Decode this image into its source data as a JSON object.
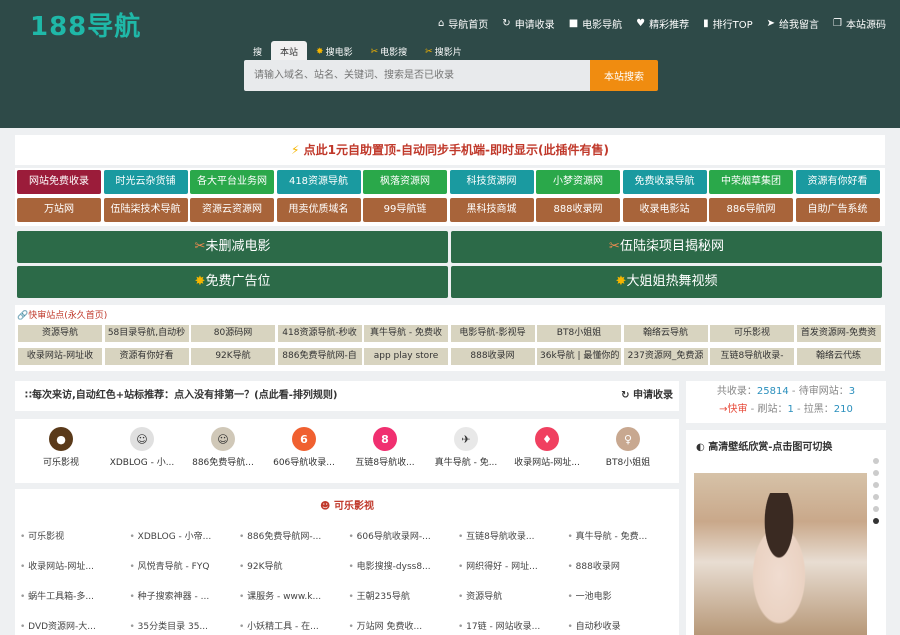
{
  "logo": "188导航",
  "topnav": [
    {
      "icon": "home-icon",
      "glyph": "⌂",
      "label": "导航首页"
    },
    {
      "icon": "refresh-icon",
      "glyph": "↻",
      "label": "申请收录"
    },
    {
      "icon": "video-icon",
      "glyph": "■",
      "label": "电影导航"
    },
    {
      "icon": "heart-icon",
      "glyph": "♥",
      "label": "精彩推荐"
    },
    {
      "icon": "chart-icon",
      "glyph": "▮",
      "label": "排行TOP"
    },
    {
      "icon": "send-icon",
      "glyph": "➤",
      "label": "给我留言"
    },
    {
      "icon": "copy-icon",
      "glyph": "❐",
      "label": "本站源码"
    }
  ],
  "search": {
    "prefix": "搜",
    "tabs": [
      "本站",
      "搜电影",
      "电影搜",
      "搜影片"
    ],
    "placeholder": "请输入域名、站名、关键词、搜索是否已收录",
    "button": "本站搜索"
  },
  "promo": "点此1元自助置顶-自动同步手机端-即时显示(此插件有售)",
  "grid_row1": [
    {
      "label": "网站免费收录",
      "color": "#9b1c3a"
    },
    {
      "label": "时光云杂货铺",
      "color": "#1a9aa0"
    },
    {
      "label": "各大平台业务网",
      "color": "#2aa84a"
    },
    {
      "label": "418资源导航",
      "color": "#1a9aa0"
    },
    {
      "label": "枫落资源网",
      "color": "#2aa84a"
    },
    {
      "label": "科技货源网",
      "color": "#1a9aa0"
    },
    {
      "label": "小梦资源网",
      "color": "#2aa84a"
    },
    {
      "label": "免费收录导航",
      "color": "#1a9aa0"
    },
    {
      "label": "中荣烟草集团",
      "color": "#2aa84a"
    },
    {
      "label": "资源有你好看",
      "color": "#1a9aa0"
    }
  ],
  "grid_row2": [
    {
      "label": "万站网",
      "color": "#a8643a"
    },
    {
      "label": "伍陆柒技术导航",
      "color": "#a8643a"
    },
    {
      "label": "资源云资源网",
      "color": "#a8643a"
    },
    {
      "label": "甩卖优质域名",
      "color": "#a8643a"
    },
    {
      "label": "99导航链",
      "color": "#a8643a"
    },
    {
      "label": "黑科技商城",
      "color": "#a8643a"
    },
    {
      "label": "888收录网",
      "color": "#a8643a"
    },
    {
      "label": "收录电影站",
      "color": "#a8643a"
    },
    {
      "label": "886导航网",
      "color": "#a8643a"
    },
    {
      "label": "自助广告系统",
      "color": "#a8643a"
    }
  ],
  "big_buttons": [
    "未删减电影",
    "伍陆柒项目揭秘网",
    "免费广告位",
    "大姐姐热舞视频"
  ],
  "quick_title": "快审站点(永久首页)",
  "quick_row1": [
    "资源导航",
    "58目录导航,自动秒",
    "80源码网",
    "418资源导航-秒收",
    "真牛导航 - 免费收",
    "电影导航-影视导",
    "BT8小姐姐",
    "翰络云导航",
    "可乐影视",
    "首发资源网-免费资"
  ],
  "quick_row2": [
    "收录网站-网址收",
    "资源有你好看",
    "92K导航",
    "886免费导航网-自",
    "app play store",
    "888收录网",
    "36k导航 | 最懂你的",
    "237资源网_免费源",
    "互链8导航收录-",
    "翰络云代练"
  ],
  "notice": "每次来访,自动红色+站标推荐：点入没有排第一？(点此看-排列规则)",
  "notice_apply": "申请收录",
  "stats": {
    "total_label": "共收录：",
    "total": "25814",
    "pending_label": " - 待审网站：",
    "pending": "3",
    "fast_label": "→快审",
    "refresh_label": " - 刷站：",
    "refresh": "1",
    "top_label": " - 拉黑：",
    "top": "210"
  },
  "icon_sites": [
    {
      "label": "可乐影视",
      "color": "#5a3a1a",
      "glyph": "●"
    },
    {
      "label": "XDBLOG - 小...",
      "color": "#e0e0e0",
      "glyph": "☺"
    },
    {
      "label": "886免费导航...",
      "color": "#d0c8b8",
      "glyph": "☺"
    },
    {
      "label": "606导航收录...",
      "color": "#f06030",
      "glyph": "6"
    },
    {
      "label": "互链8导航收...",
      "color": "#f03070",
      "glyph": "8"
    },
    {
      "label": "真牛导航 - 免...",
      "color": "#e8e8e8",
      "glyph": "✈"
    },
    {
      "label": "收录网站-网址...",
      "color": "#f04060",
      "glyph": "♦"
    },
    {
      "label": "BT8小姐姐",
      "color": "#c8a890",
      "glyph": "♀"
    }
  ],
  "list_title": "可乐影视",
  "list_rows": [
    [
      "可乐影视",
      "XDBLOG - 小帝...",
      "886免费导航网-...",
      "606导航收录网-...",
      "互链8导航收录...",
      "真牛导航 - 免费..."
    ],
    [
      "收录网站-网址...",
      "风悦青导航 - FYQ",
      "92K导航",
      "电影搜搜-dyss8...",
      "网织得好 - 网址...",
      "888收录网"
    ],
    [
      "蜗牛工具箱-多...",
      "种子搜索神器 - ...",
      "课服务 - www.k...",
      "王朝235导航",
      "资源导航",
      "一池电影"
    ],
    [
      "DVD资源网-大...",
      "35分类目录 35...",
      "小妖精工具 - 在...",
      "万站网 免费收...",
      "17链 - 网站收录...",
      "自动秒收录"
    ]
  ],
  "wall_title": "高清壁纸欣赏-点击图可切换"
}
